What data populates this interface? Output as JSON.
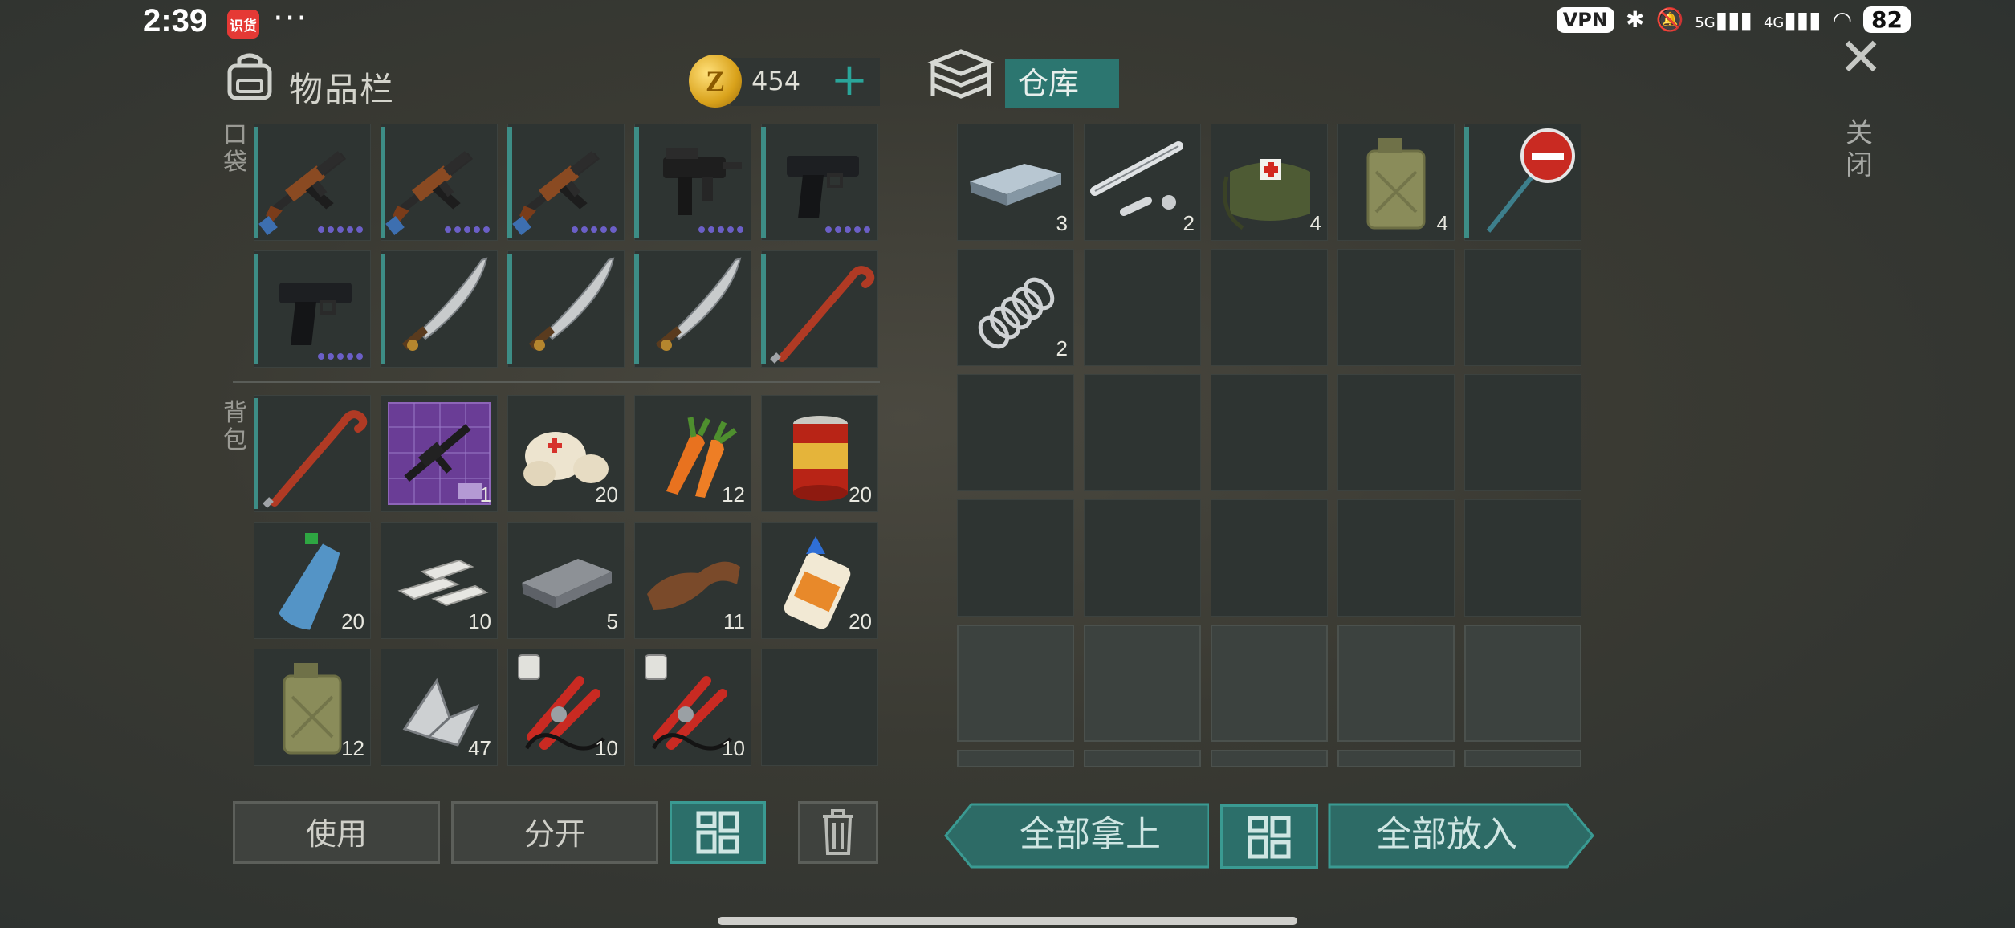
{
  "status_bar": {
    "time": "2:39",
    "badge": "识货",
    "dots": "···",
    "vpn": "VPN",
    "net1": "5G",
    "net2": "4G",
    "battery": "82"
  },
  "inventory": {
    "title": "物品栏",
    "coins": "454",
    "coin_symbol": "Z",
    "pocket_label": "口袋",
    "backpack_label": "背包",
    "pocket_items": [
      {
        "icon": "ak-rifle-icon",
        "count": "",
        "dots": 5
      },
      {
        "icon": "ak-rifle-icon",
        "count": "",
        "dots": 5
      },
      {
        "icon": "ak-rifle-icon",
        "count": "",
        "dots": 5
      },
      {
        "icon": "uzi-icon",
        "count": "",
        "dots": 5
      },
      {
        "icon": "pistol-icon",
        "count": "",
        "dots": 5
      },
      {
        "icon": "pistol-icon",
        "count": "",
        "dots": 5
      },
      {
        "icon": "machete-icon",
        "count": "",
        "dots": 0
      },
      {
        "icon": "machete-icon",
        "count": "",
        "dots": 0
      },
      {
        "icon": "machete-icon",
        "count": "",
        "dots": 0
      },
      {
        "icon": "crowbar-icon",
        "count": "",
        "dots": 0
      }
    ],
    "backpack_items": [
      {
        "icon": "crowbar-icon",
        "count": ""
      },
      {
        "icon": "rifle-blueprint-icon",
        "count": "1"
      },
      {
        "icon": "bandage-icon",
        "count": "20"
      },
      {
        "icon": "carrot-icon",
        "count": "12"
      },
      {
        "icon": "canned-food-icon",
        "count": "20"
      },
      {
        "icon": "water-bottle-icon",
        "count": "20"
      },
      {
        "icon": "metal-bars-icon",
        "count": "10"
      },
      {
        "icon": "iron-ingot-icon",
        "count": "5"
      },
      {
        "icon": "leather-icon",
        "count": "11"
      },
      {
        "icon": "glue-icon",
        "count": "20"
      },
      {
        "icon": "jerry-can-icon",
        "count": "12"
      },
      {
        "icon": "scrap-metal-icon",
        "count": "47"
      },
      {
        "icon": "pliers-kit-icon",
        "count": "10"
      },
      {
        "icon": "pliers-kit-icon",
        "count": "10"
      },
      {
        "icon": "",
        "count": ""
      }
    ],
    "buttons": {
      "use": "使用",
      "split": "分开"
    }
  },
  "storage": {
    "title": "仓库",
    "items": [
      {
        "icon": "steel-ingot-icon",
        "count": "3"
      },
      {
        "icon": "pipe-parts-icon",
        "count": "2"
      },
      {
        "icon": "medkit-bag-icon",
        "count": "4"
      },
      {
        "icon": "jerry-can-icon",
        "count": "4"
      },
      {
        "icon": "stop-sign-icon",
        "count": ""
      },
      {
        "icon": "spring-icon",
        "count": "2"
      }
    ],
    "buttons": {
      "take_all": "全部拿上",
      "put_all": "全部放入"
    }
  },
  "close_label": "关闭",
  "colors": {
    "accent": "#2c6f6a",
    "slot": "#2e3432",
    "dot": "#6b5fc7"
  }
}
